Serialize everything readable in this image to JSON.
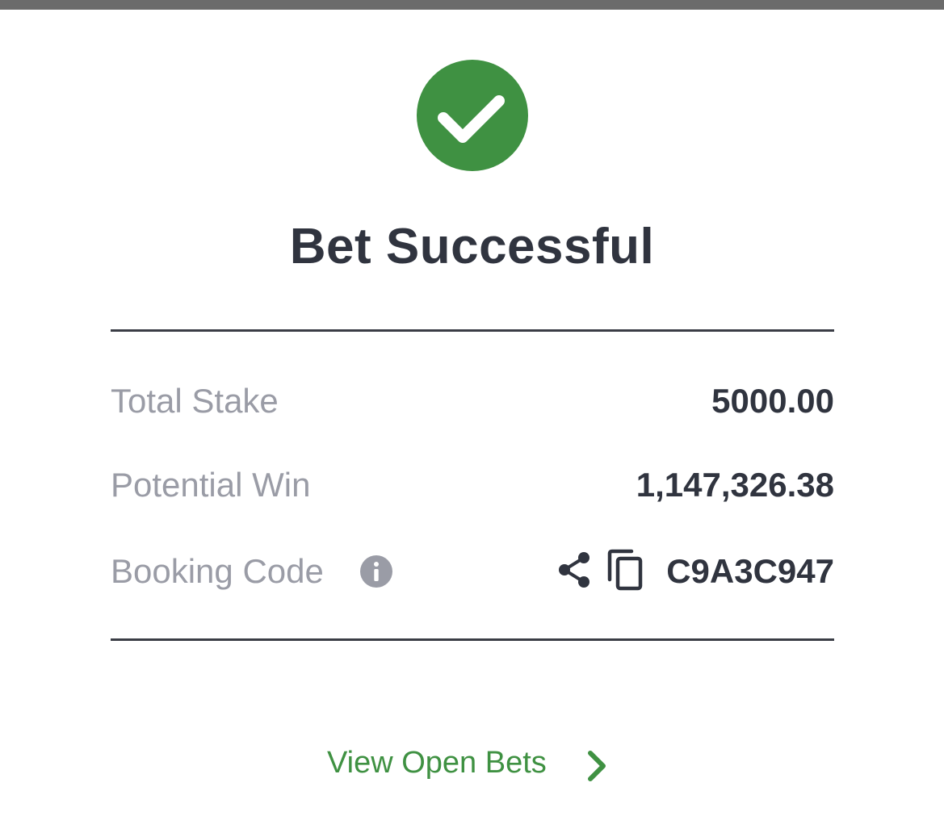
{
  "header": {
    "title": "Bet Successful",
    "status_color": "#3f9142",
    "status_icon": "checkmark-icon"
  },
  "summary": {
    "total_stake": {
      "label": "Total Stake",
      "value": "5000.00"
    },
    "potential_win": {
      "label": "Potential Win",
      "value": "1,147,326.38"
    },
    "booking_code": {
      "label": "Booking Code",
      "value": "C9A3C947",
      "icons": [
        "info-icon",
        "share-icon",
        "copy-icon"
      ]
    }
  },
  "footer": {
    "link_label": "View Open Bets",
    "link_icon": "chevron-right-icon",
    "link_color": "#3f9142"
  }
}
